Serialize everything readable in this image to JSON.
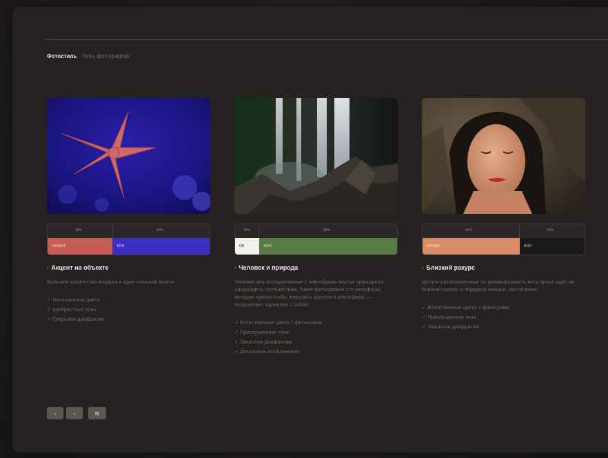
{
  "tabs": {
    "active": "Фотостиль",
    "other": "Типы фотографий"
  },
  "cards": [
    {
      "image": "starfish-photo",
      "ratio": {
        "left_pct": "40%",
        "right_pct": "60%",
        "left_label": "ОБЪЕКТ",
        "right_label": "ФОН",
        "left_color": "#c85d55",
        "right_color": "#3a2fc0",
        "left_fraction": 0.4
      },
      "title": "Акцент на объекте",
      "description": "Большое количество воздуха и один сильный акцент",
      "checks": [
        "Насыщенные цвета",
        "Контрастные тона",
        "Открытая диафрагма"
      ]
    },
    {
      "image": "waterfall-photo",
      "ratio": {
        "left_pct": "15%",
        "right_pct": "85%",
        "left_label": "ОБ",
        "right_label": "ФОН",
        "left_color": "#f3f1ee",
        "right_color": "#5a7a45",
        "left_fraction": 0.15
      },
      "title": "Человек и природа",
      "description": "Человек или ассоциативные с ним образы внутри природного ландшафта, путешествия. Такие фотографии это метафоры, которые нужны чтобы погрузить зрителя в атмосферу — погружение, единение с собой.",
      "checks": [
        "Естественные цвета с фильтрами",
        "Приглушенные тона",
        "Закрытая диафрагма",
        "Детальное изображение"
      ]
    },
    {
      "image": "portrait-photo",
      "ratio": {
        "left_pct": "60%",
        "right_pct": "40%",
        "left_label": "ОБЪЕКТ",
        "right_label": "ФОН",
        "left_color": "#d98c6a",
        "right_color": "#1c1a19",
        "left_fraction": 0.6
      },
      "title": "Близкий ракурс",
      "description": "Детали расположенные по краям формата, весь фокус идёт на близкий ракурс и передачу эмоций, настроения.",
      "checks": [
        "Естественные цвета с фильтрами",
        "Приглушенные тона",
        "Закрытая диафрагма"
      ]
    }
  ],
  "controls": [
    "‹",
    "›",
    "⊞"
  ]
}
